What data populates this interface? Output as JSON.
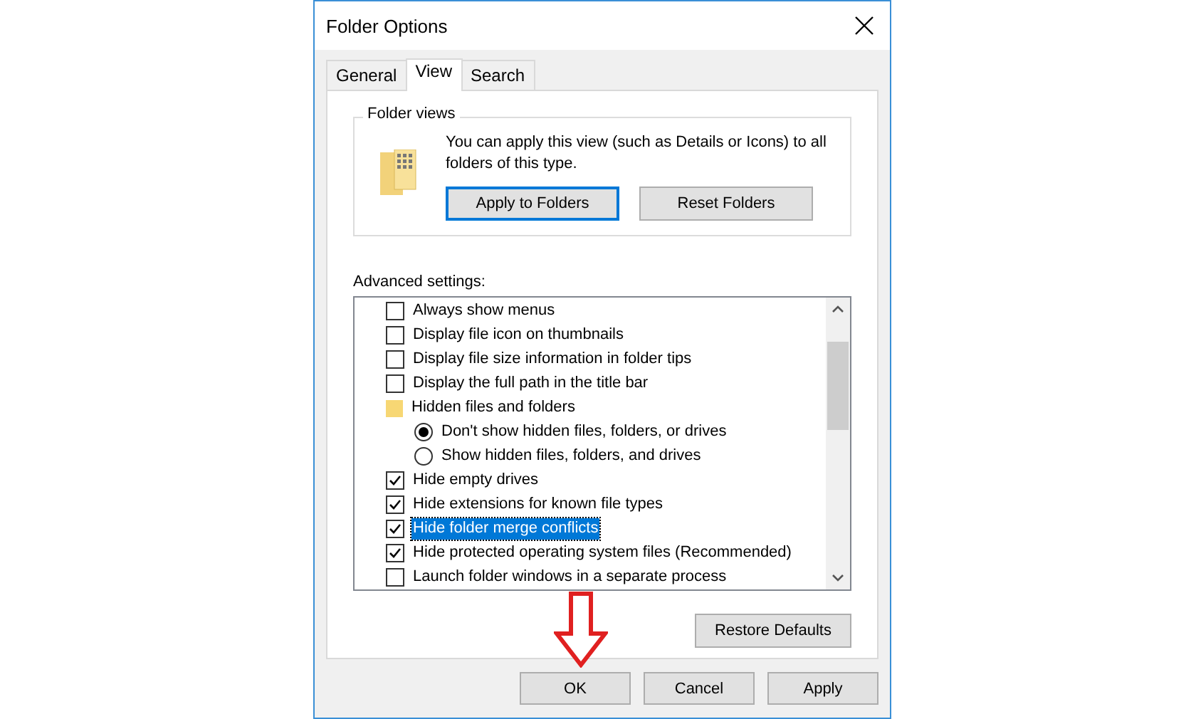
{
  "window": {
    "title": "Folder Options"
  },
  "tabs": [
    {
      "label": "General",
      "selected": false
    },
    {
      "label": "View",
      "selected": true
    },
    {
      "label": "Search",
      "selected": false
    }
  ],
  "folder_views": {
    "title": "Folder views",
    "description": "You can apply this view (such as Details or Icons) to all folders of this type.",
    "buttons": [
      {
        "label": "Apply to Folders",
        "focused": true
      },
      {
        "label": "Reset Folders",
        "focused": false
      }
    ]
  },
  "advanced_settings": {
    "label": "Advanced settings:",
    "items": [
      {
        "kind": "checkbox",
        "label": "Always show menus",
        "checked": false,
        "selected": false
      },
      {
        "kind": "checkbox",
        "label": "Display file icon on thumbnails",
        "checked": false,
        "selected": false
      },
      {
        "kind": "checkbox",
        "label": "Display file size information in folder tips",
        "checked": false,
        "selected": false
      },
      {
        "kind": "checkbox",
        "label": "Display the full path in the title bar",
        "checked": false,
        "selected": false
      },
      {
        "kind": "folder",
        "label": "Hidden files and folders",
        "selected": false,
        "children": [
          {
            "kind": "radio",
            "label": "Don't show hidden files, folders, or drives",
            "checked": true,
            "selected": false
          },
          {
            "kind": "radio",
            "label": "Show hidden files, folders, and drives",
            "checked": false,
            "selected": false
          }
        ]
      },
      {
        "kind": "checkbox",
        "label": "Hide empty drives",
        "checked": true,
        "selected": false
      },
      {
        "kind": "checkbox",
        "label": "Hide extensions for known file types",
        "checked": true,
        "selected": false
      },
      {
        "kind": "checkbox",
        "label": "Hide folder merge conflicts",
        "checked": true,
        "selected": true
      },
      {
        "kind": "checkbox",
        "label": "Hide protected operating system files (Recommended)",
        "checked": true,
        "selected": false
      },
      {
        "kind": "checkbox",
        "label": "Launch folder windows in a separate process",
        "checked": false,
        "selected": false
      }
    ],
    "restore_button": "Restore Defaults"
  },
  "dialog_buttons": [
    "OK",
    "Cancel",
    "Apply"
  ]
}
